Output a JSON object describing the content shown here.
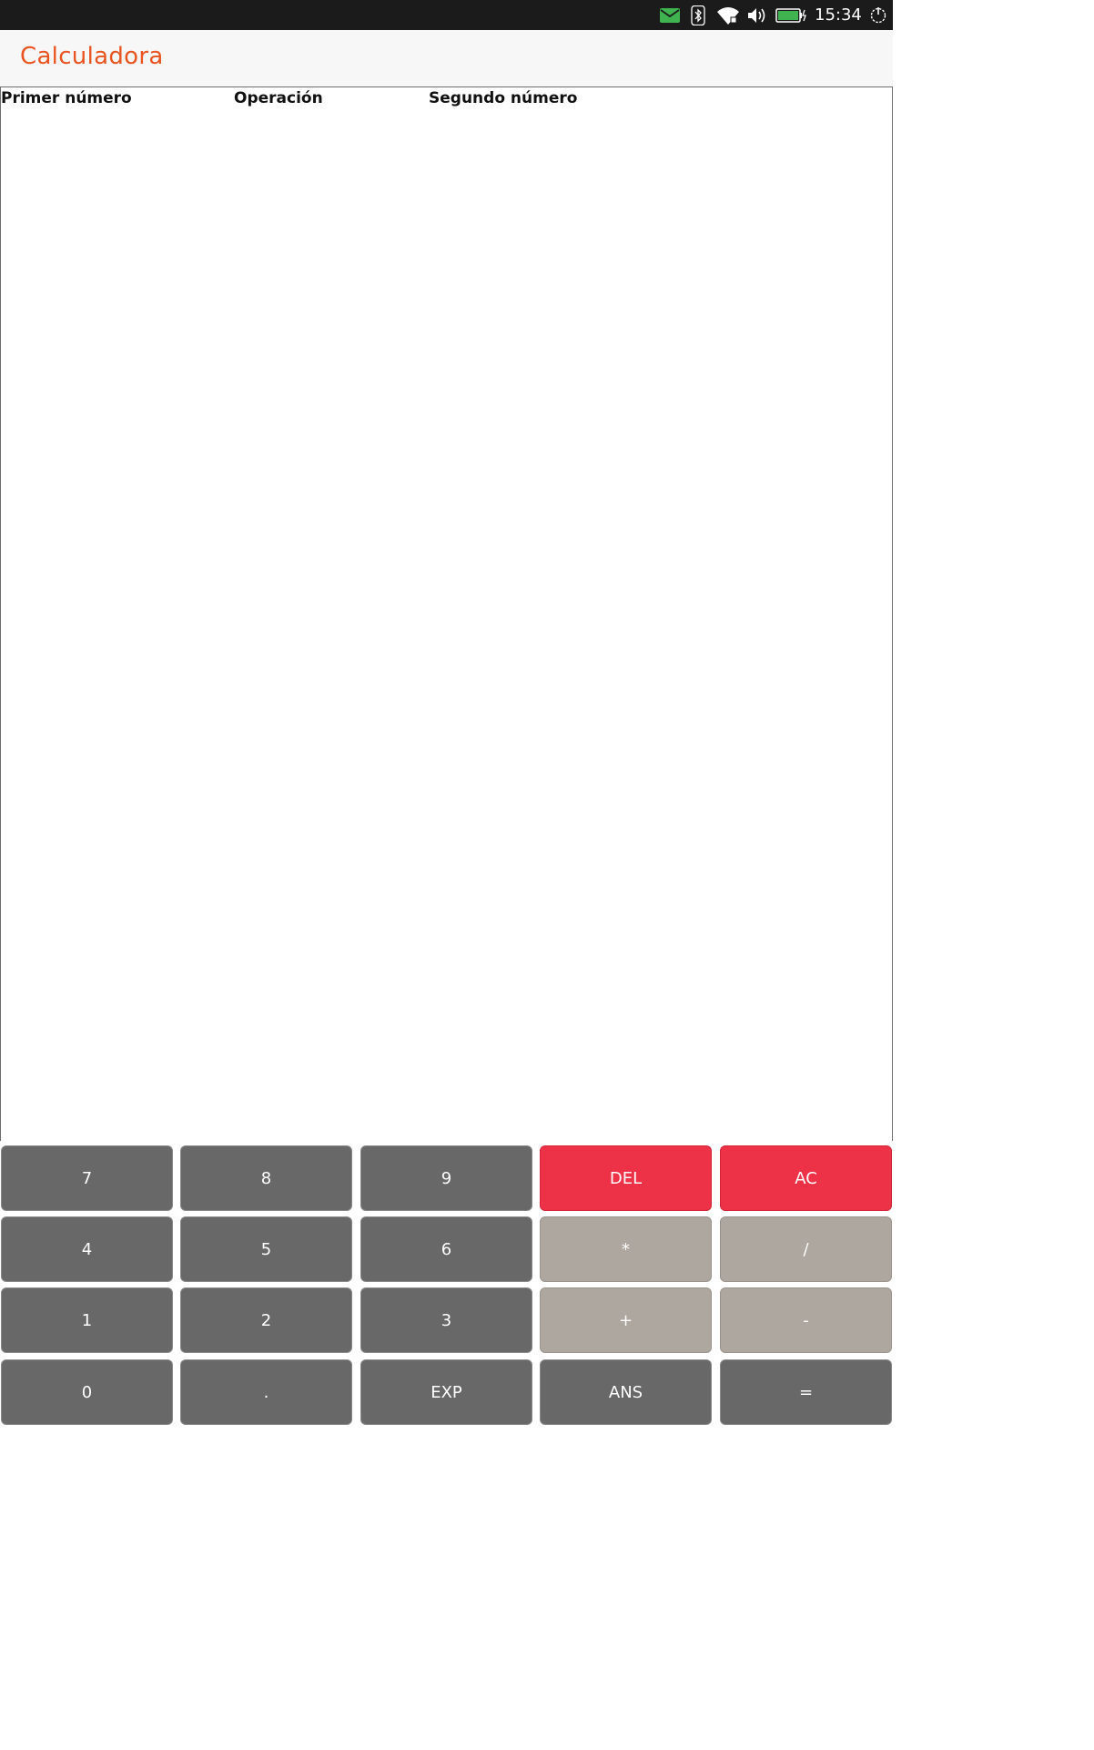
{
  "status_bar": {
    "time": "15:34",
    "icons": [
      "message-icon",
      "bluetooth-icon",
      "wifi-icon",
      "volume-icon",
      "battery-icon",
      "power-icon"
    ],
    "message_color": "#3eb34f",
    "battery_color": "#3eb34f"
  },
  "header": {
    "title": "Calculadora",
    "title_color": "#e95420"
  },
  "columns": {
    "first": "Primer número",
    "operation": "Operación",
    "second": "Segundo número"
  },
  "keypad": {
    "rows": [
      [
        {
          "label": "7",
          "name": "key-7",
          "style": "dark"
        },
        {
          "label": "8",
          "name": "key-8",
          "style": "dark"
        },
        {
          "label": "9",
          "name": "key-9",
          "style": "dark"
        },
        {
          "label": "DEL",
          "name": "key-del",
          "style": "red"
        },
        {
          "label": "AC",
          "name": "key-ac",
          "style": "red"
        }
      ],
      [
        {
          "label": "4",
          "name": "key-4",
          "style": "dark"
        },
        {
          "label": "5",
          "name": "key-5",
          "style": "dark"
        },
        {
          "label": "6",
          "name": "key-6",
          "style": "dark"
        },
        {
          "label": "*",
          "name": "key-multiply",
          "style": "light"
        },
        {
          "label": "/",
          "name": "key-divide",
          "style": "light"
        }
      ],
      [
        {
          "label": "1",
          "name": "key-1",
          "style": "dark"
        },
        {
          "label": "2",
          "name": "key-2",
          "style": "dark"
        },
        {
          "label": "3",
          "name": "key-3",
          "style": "dark"
        },
        {
          "label": "+",
          "name": "key-plus",
          "style": "light"
        },
        {
          "label": "-",
          "name": "key-minus",
          "style": "light"
        }
      ],
      [
        {
          "label": "0",
          "name": "key-0",
          "style": "dark"
        },
        {
          "label": ".",
          "name": "key-decimal",
          "style": "dark"
        },
        {
          "label": "EXP",
          "name": "key-exp",
          "style": "dark"
        },
        {
          "label": "ANS",
          "name": "key-ans",
          "style": "dark"
        },
        {
          "label": "=",
          "name": "key-equals",
          "style": "dark"
        }
      ]
    ],
    "colors": {
      "dark": "#686868",
      "red": "#ed3146",
      "light": "#aea79f"
    }
  }
}
